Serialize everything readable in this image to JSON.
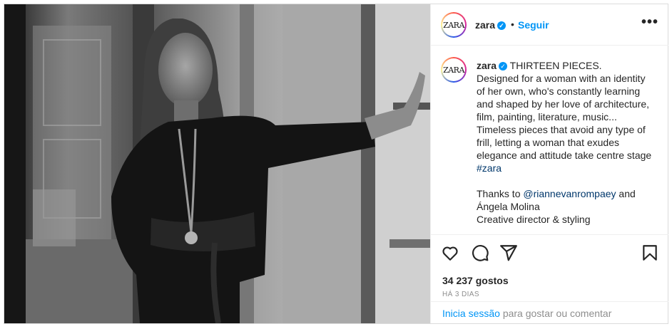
{
  "post": {
    "username": "zara",
    "avatar_text": "ZARA",
    "follow_label": "Seguir",
    "separator": "•",
    "more_label": "•••",
    "caption": {
      "line1": "THIRTEEN PIECES.",
      "body": "Designed for a woman with an identity of her own, who's constantly learning and shaped by her love of architecture, film, painting, literature, music... Timeless pieces that avoid any type of frill, letting a woman that exudes elegance and attitude take centre stage ",
      "hashtag": "#zara",
      "thanks_prefix": "Thanks to ",
      "mention": "@riannevanrompaey",
      "thanks_suffix": " and Ángela Molina",
      "credit": "Creative director & styling"
    },
    "likes": "34 237 gostos",
    "time": "HÁ 3 DIAS",
    "login_link": "Inicia sessão",
    "login_rest": " para gostar ou comentar"
  },
  "icons": [
    "heart-icon",
    "comment-icon",
    "share-icon",
    "bookmark-icon",
    "verified-icon",
    "more-icon"
  ],
  "colors": {
    "accent": "#0095f6",
    "text": "#262626",
    "muted": "#8e8e8e",
    "link": "#00376b"
  }
}
